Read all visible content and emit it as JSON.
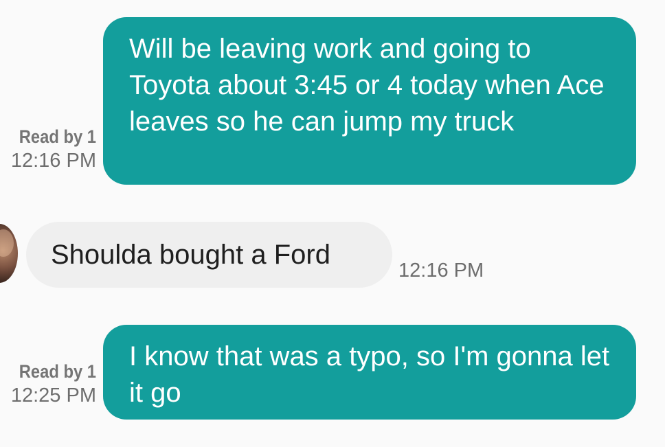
{
  "messages": [
    {
      "direction": "outgoing",
      "text": "Will be leaving work and going to Toyota about 3:45 or 4 today when Ace leaves so he can jump my truck",
      "read_status": "Read by 1",
      "time": "12:16 PM"
    },
    {
      "direction": "incoming",
      "text": "Shoulda bought a Ford",
      "time": "12:16 PM",
      "avatar": "contact-avatar"
    },
    {
      "direction": "outgoing",
      "text": "I know that was a typo, so I'm gonna let it go",
      "read_status": "Read by 1",
      "time": "12:25 PM"
    }
  ],
  "colors": {
    "outgoing_bubble": "#139e9c",
    "incoming_bubble": "#efefef",
    "background": "#fafafa",
    "meta_text": "#6d6d6d"
  }
}
